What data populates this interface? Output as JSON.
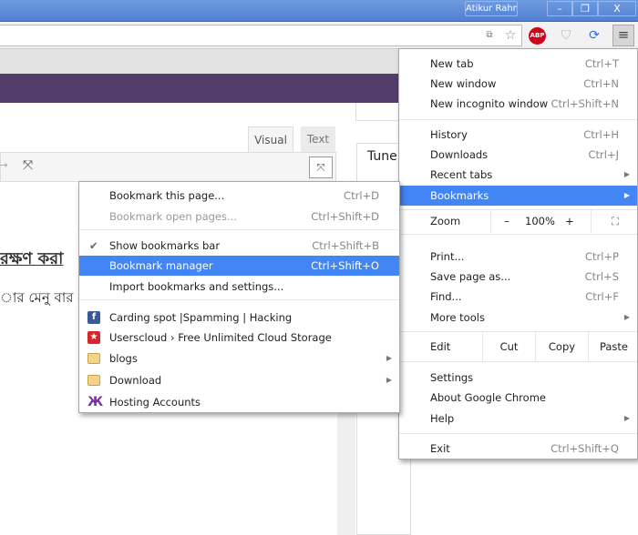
{
  "window": {
    "profile_name": "Atikur Rahman...",
    "minimize": "–",
    "restore": "❐",
    "close": "X"
  },
  "toolbar": {
    "translate_icon": "translate-icon",
    "star_icon": "☆",
    "abp_label": "ABP",
    "menu_icon": "≡"
  },
  "editor": {
    "tab_visual": "Visual",
    "tab_text": "Text",
    "panel_title": "Tune",
    "heading": "রক্ষণ করা",
    "body_line": "ার মেনু বার ে"
  },
  "chrome_menu": {
    "new_tab": {
      "label": "New tab",
      "shortcut": "Ctrl+T"
    },
    "new_window": {
      "label": "New window",
      "shortcut": "Ctrl+N"
    },
    "incognito": {
      "label": "New incognito window",
      "shortcut": "Ctrl+Shift+N"
    },
    "history": {
      "label": "History",
      "shortcut": "Ctrl+H"
    },
    "downloads": {
      "label": "Downloads",
      "shortcut": "Ctrl+J"
    },
    "recent_tabs": {
      "label": "Recent tabs"
    },
    "bookmarks": {
      "label": "Bookmarks"
    },
    "zoom": {
      "label": "Zoom",
      "minus": "–",
      "value": "100%",
      "plus": "+"
    },
    "print": {
      "label": "Print...",
      "shortcut": "Ctrl+P"
    },
    "save_page": {
      "label": "Save page as...",
      "shortcut": "Ctrl+S"
    },
    "find": {
      "label": "Find...",
      "shortcut": "Ctrl+F"
    },
    "more_tools": {
      "label": "More tools"
    },
    "edit": {
      "label": "Edit",
      "cut": "Cut",
      "copy": "Copy",
      "paste": "Paste"
    },
    "settings": {
      "label": "Settings"
    },
    "about": {
      "label": "About Google Chrome"
    },
    "help": {
      "label": "Help"
    },
    "exit": {
      "label": "Exit",
      "shortcut": "Ctrl+Shift+Q"
    }
  },
  "bookmarks_menu": {
    "bookmark_page": {
      "label": "Bookmark this page...",
      "shortcut": "Ctrl+D"
    },
    "bookmark_open": {
      "label": "Bookmark open pages...",
      "shortcut": "Ctrl+Shift+D"
    },
    "show_bar": {
      "label": "Show bookmarks bar",
      "shortcut": "Ctrl+Shift+B",
      "checked": true
    },
    "manager": {
      "label": "Bookmark manager",
      "shortcut": "Ctrl+Shift+O"
    },
    "import": {
      "label": "Import bookmarks and settings..."
    },
    "items": [
      {
        "label": "Carding spot |Spamming | Hacking",
        "icon": "facebook-icon"
      },
      {
        "label": "Userscloud › Free Unlimited Cloud Storage",
        "icon": "star-icon"
      },
      {
        "label": "blogs",
        "icon": "folder-icon"
      },
      {
        "label": "Download",
        "icon": "folder-icon"
      },
      {
        "label": "Hosting Accounts",
        "icon": "hosting-icon"
      }
    ]
  },
  "colors": {
    "highlight": "#4285f4",
    "purple": "#523d6a",
    "titlebar": "#5b8bd8"
  }
}
